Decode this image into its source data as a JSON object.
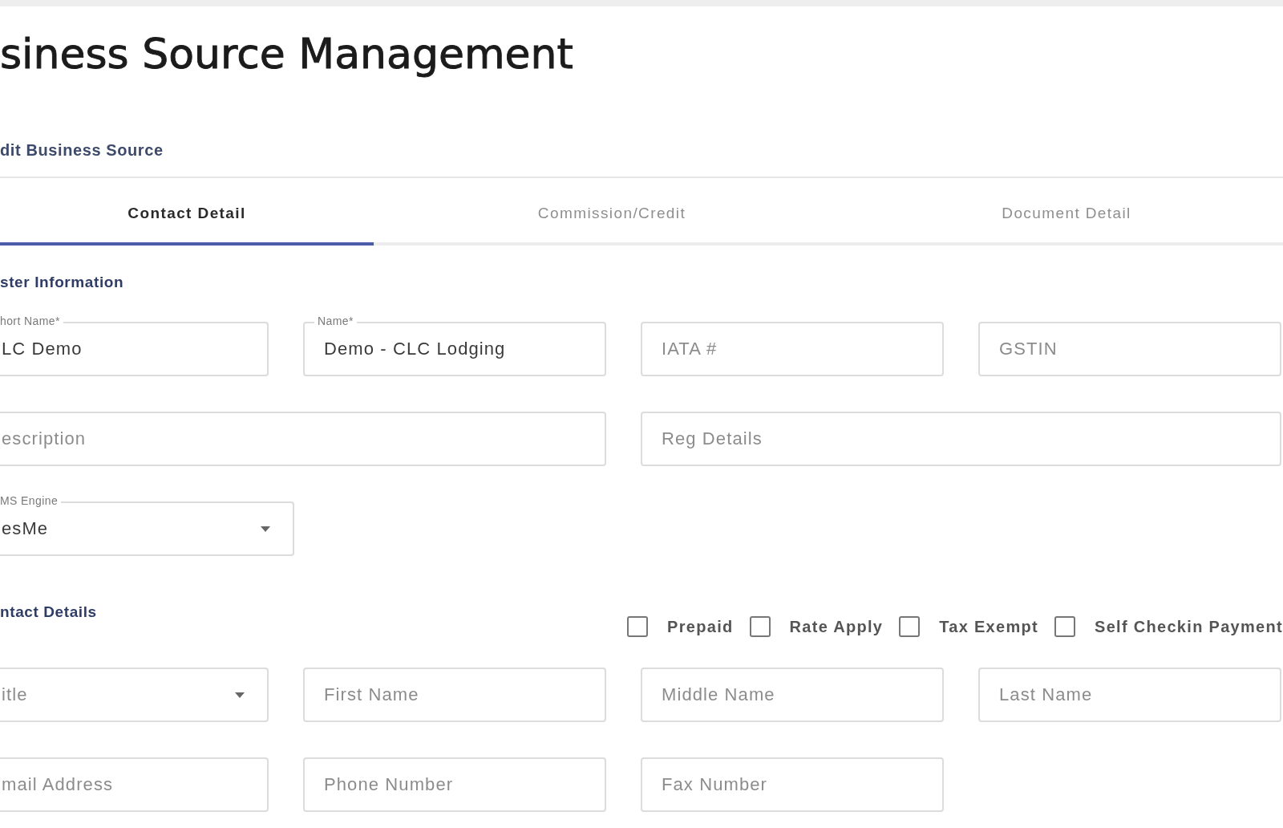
{
  "header": {
    "title": "siness Source Management",
    "subtitle": "dit Business Source"
  },
  "tabs": [
    {
      "label": "Contact Detail",
      "selected": true
    },
    {
      "label": "Commission/Credit",
      "selected": false
    },
    {
      "label": "Document Detail",
      "selected": false
    }
  ],
  "master_information": {
    "heading": "ster Information",
    "fields": [
      {
        "kind": "text",
        "label": "hort Name*",
        "value": "LC Demo"
      },
      {
        "kind": "text",
        "label": "Name*",
        "value": "Demo - CLC Lodging"
      },
      {
        "kind": "text",
        "placeholder": "IATA #"
      },
      {
        "kind": "text",
        "placeholder": "GSTIN"
      },
      {
        "kind": "text",
        "placeholder": "escription"
      },
      {
        "kind": "text",
        "placeholder": "Reg Details"
      },
      {
        "kind": "select",
        "label": "MS Engine",
        "value": "esMe"
      }
    ]
  },
  "contact_details": {
    "heading": "ntact Details",
    "options": [
      {
        "label": "Prepaid",
        "checked": false
      },
      {
        "label": "Rate Apply",
        "checked": false
      },
      {
        "label": "Tax Exempt",
        "checked": false
      },
      {
        "label": "Self Checkin Payment",
        "checked": false
      }
    ],
    "fields": [
      {
        "kind": "select",
        "placeholder": "itle"
      },
      {
        "kind": "text",
        "placeholder": "First Name"
      },
      {
        "kind": "text",
        "placeholder": "Middle Name"
      },
      {
        "kind": "text",
        "placeholder": "Last Name"
      },
      {
        "kind": "text",
        "placeholder": "mail Address"
      },
      {
        "kind": "text",
        "placeholder": "Phone Number"
      },
      {
        "kind": "text",
        "placeholder": "Fax Number"
      }
    ]
  }
}
